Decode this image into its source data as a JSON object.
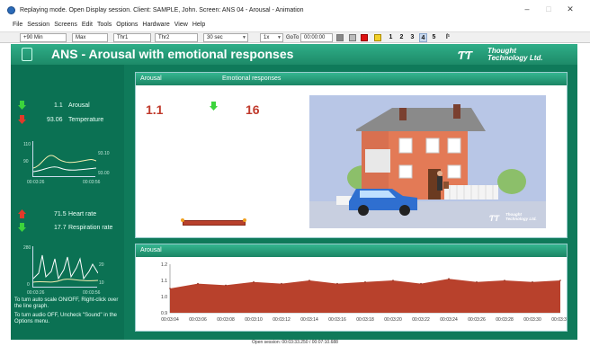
{
  "window": {
    "title": "Replaying mode. Open Display session. Client: SAMPLE, John. Screen: ANS 04 - Arousal - Animation",
    "minimize": "–",
    "maximize": "□",
    "close": "✕"
  },
  "menu": [
    "File",
    "Session",
    "Screens",
    "Edit",
    "Tools",
    "Options",
    "Hardware",
    "View",
    "Help"
  ],
  "toolbar": {
    "min_label": "Min",
    "min_prefix": "+90",
    "max_label": "Max",
    "thr1_label": "Thr1",
    "thr2_label": "Thr2",
    "time_label": "30 sec",
    "speed_label": "1x",
    "goto_label": "GoTo",
    "goto_value": "00:00:00",
    "screen_numbers": [
      "1",
      "2",
      "3",
      "4",
      "5"
    ],
    "active_screen": "4",
    "extra_label": "ſ¹"
  },
  "header": {
    "title": "ANS - Arousal with emotional responses",
    "logo_line1": "Thought",
    "logo_line2": "Technology Ltd."
  },
  "left_panel": {
    "arousal_value": "1.1",
    "arousal_label": "Arousal",
    "temp_value": "93.06",
    "temp_label": "Temperature",
    "graph1": {
      "y_top": "110",
      "y_mid": "90",
      "r_top": "93.10",
      "r_bot": "93.00",
      "x_left": "00:03:26",
      "x_right": "00:03:56"
    },
    "hr_value": "71.5",
    "hr_label": "Heart rate",
    "resp_value": "17.7",
    "resp_label": "Respiration rate",
    "graph2": {
      "y_top": "280",
      "y_mid": "0",
      "r_top": "20",
      "r_bot": "10",
      "x_left": "00:03:26",
      "x_right": "00:03:56"
    },
    "note1": "To turn auto scale ON/OFF, Right-click over the line graph.",
    "note2": "To turn audio OFF, Uncheck \"Sound\" in the Options menu."
  },
  "top_panel": {
    "arousal_header": "Arousal",
    "emotional_header": "Emotional responses",
    "arousal_value": "1.1",
    "emotional_value": "16",
    "scene_logo_line1": "Thought",
    "scene_logo_line2": "Technology Ltd."
  },
  "bottom_panel": {
    "header": "Arousal",
    "y_ticks": [
      "1.2",
      "1.1",
      "1.0",
      "0.9"
    ],
    "x_ticks": [
      "00:03:04",
      "00:03:06",
      "00:03:08",
      "00:03:10",
      "00:03:12",
      "00:03:14",
      "00:03:16",
      "00:03:18",
      "00:03:20",
      "00:03:22",
      "00:03:24",
      "00:03:26",
      "00:03:28",
      "00:03:30",
      "00:03:32"
    ]
  },
  "chart_data": {
    "type": "area",
    "title": "Arousal",
    "xlabel": "",
    "ylabel": "",
    "ylim": [
      0.9,
      1.2
    ],
    "x": [
      "00:03:04",
      "00:03:06",
      "00:03:08",
      "00:03:10",
      "00:03:12",
      "00:03:14",
      "00:03:16",
      "00:03:18",
      "00:03:20",
      "00:03:22",
      "00:03:24",
      "00:03:26",
      "00:03:28",
      "00:03:30",
      "00:03:32"
    ],
    "values": [
      1.05,
      1.08,
      1.07,
      1.09,
      1.08,
      1.1,
      1.08,
      1.09,
      1.1,
      1.08,
      1.11,
      1.09,
      1.1,
      1.09,
      1.1
    ]
  },
  "status": "Open session: 00:03:33.250 / 00:07:10.688",
  "colors": {
    "accent": "#1d8a68",
    "value_red": "#c0392b",
    "area_fill": "#b8412c"
  }
}
